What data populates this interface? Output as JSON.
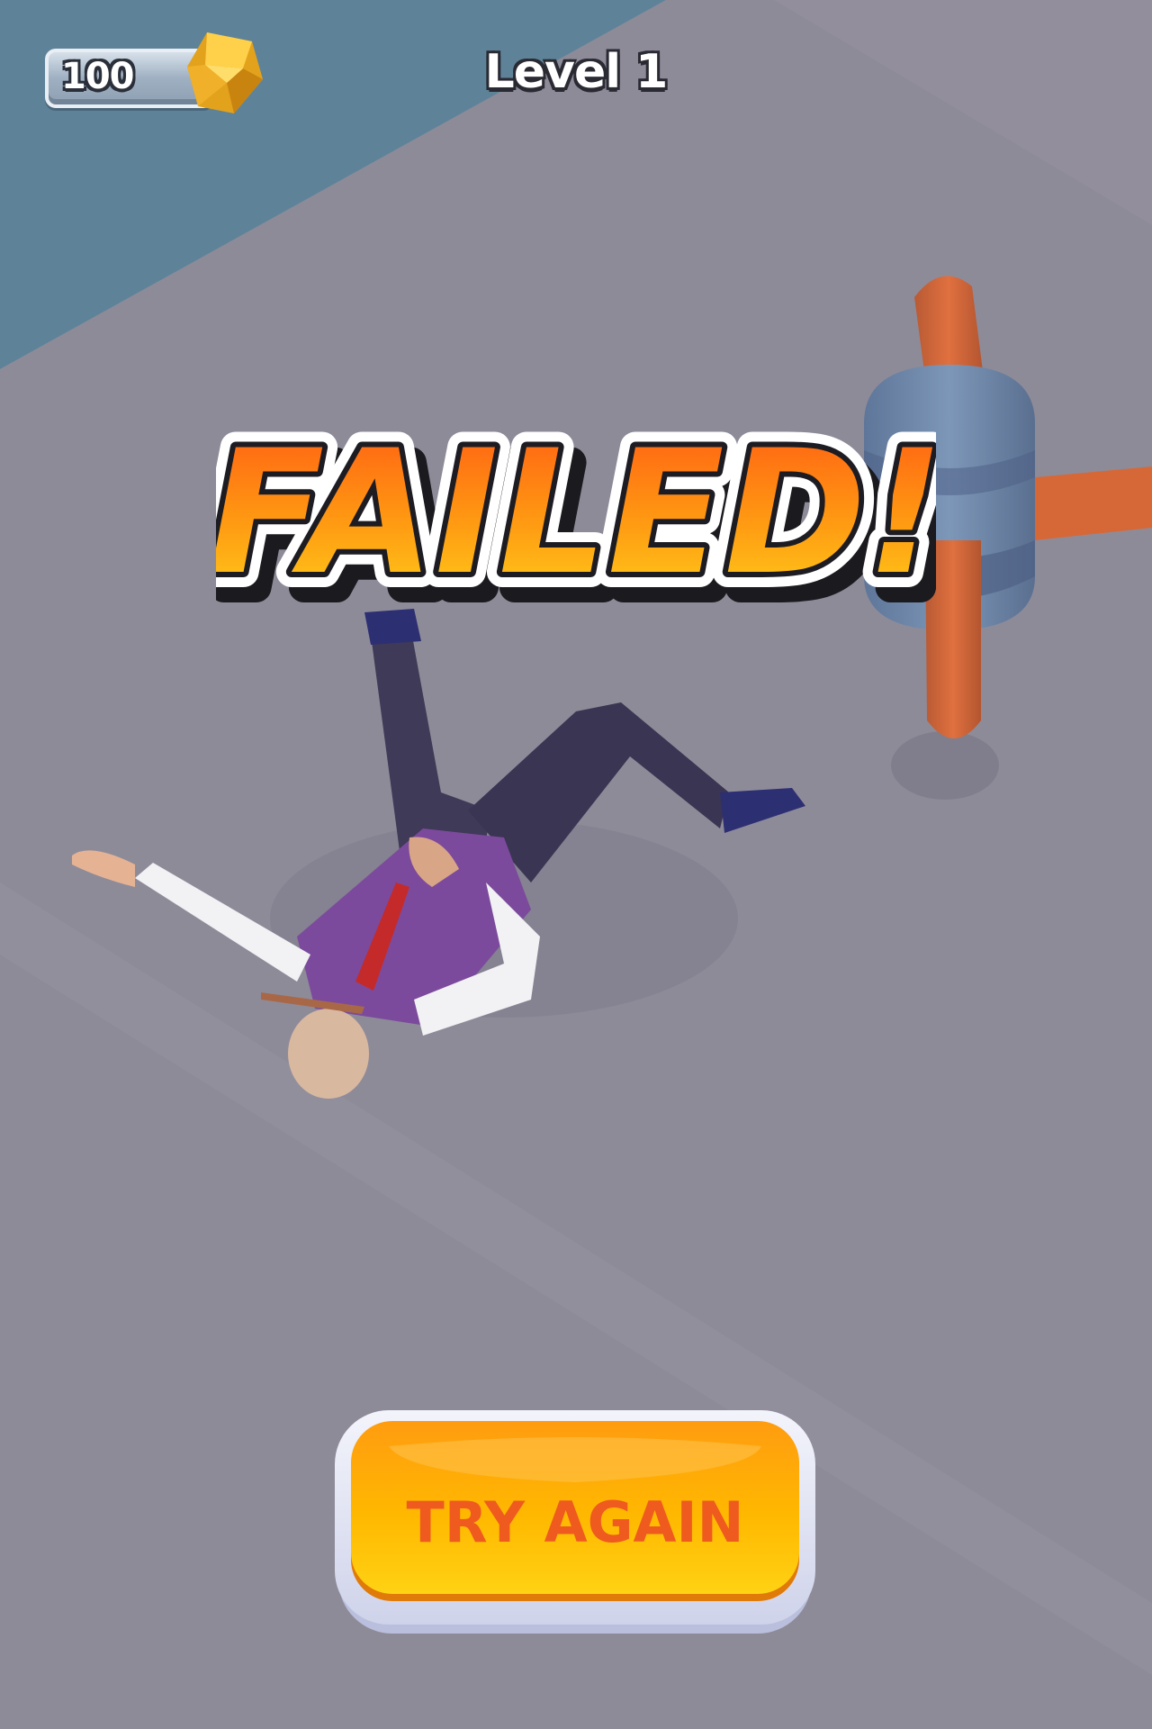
{
  "hud": {
    "coins": "100",
    "level": "Level 1",
    "gem_icon": "gold-gem-icon"
  },
  "banner": {
    "text": "FAILED!"
  },
  "actions": {
    "try_again": "TRY AGAIN"
  },
  "colors": {
    "floor": "#8e8b99",
    "water": "#5e8399",
    "banner_fill_top": "#ff5a14",
    "banner_fill_bottom": "#ffd21a",
    "button": "#ffb000",
    "button_text": "#ef5a1f"
  }
}
